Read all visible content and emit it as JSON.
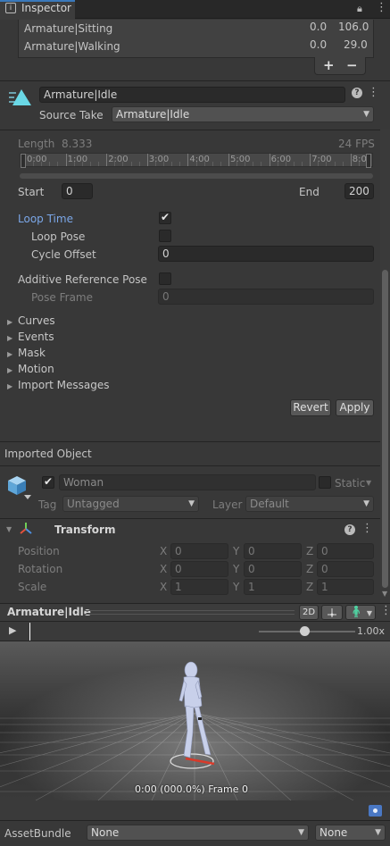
{
  "tab": {
    "title": "Inspector"
  },
  "clips": [
    {
      "name": "Armature|Sitting",
      "start": "0.0",
      "end": "106.0"
    },
    {
      "name": "Armature|Walking",
      "start": "0.0",
      "end": "29.0"
    }
  ],
  "clip_buttons": {
    "add": "+",
    "remove": "−"
  },
  "clip_header": {
    "name": "Armature|Idle",
    "source_take_label": "Source Take",
    "source_take_value": "Armature|Idle"
  },
  "timeline": {
    "length_label": "Length",
    "length_value": "8.333",
    "fps": "24 FPS",
    "ticks": [
      "0:00",
      "1:00",
      "2:00",
      "3:00",
      "4:00",
      "5:00",
      "6:00",
      "7:00",
      "8:0"
    ],
    "start_label": "Start",
    "start_value": "0",
    "end_label": "End",
    "end_value": "200"
  },
  "loop": {
    "loop_time_label": "Loop Time",
    "loop_pose_label": "Loop Pose",
    "cycle_offset_label": "Cycle Offset",
    "cycle_offset_value": "0",
    "additive_label": "Additive Reference Pose",
    "pose_frame_label": "Pose Frame",
    "pose_frame_value": "0"
  },
  "foldouts": [
    "Curves",
    "Events",
    "Mask",
    "Motion",
    "Import Messages"
  ],
  "actions": {
    "revert": "Revert",
    "apply": "Apply"
  },
  "imported": {
    "header": "Imported Object",
    "name": "Woman",
    "static_label": "Static",
    "tag_label": "Tag",
    "tag_value": "Untagged",
    "layer_label": "Layer",
    "layer_value": "Default"
  },
  "transform": {
    "title": "Transform",
    "rows": [
      {
        "label": "Position",
        "x": "0",
        "y": "0",
        "z": "0"
      },
      {
        "label": "Rotation",
        "x": "0",
        "y": "0",
        "z": "0"
      },
      {
        "label": "Scale",
        "x": "1",
        "y": "1",
        "z": "1"
      }
    ],
    "axis": {
      "x": "X",
      "y": "Y",
      "z": "Z"
    }
  },
  "preview": {
    "title": "Armature|Idle",
    "mode_2d": "2D",
    "speed": "1.00x",
    "status": "0:00 (000.0%) Frame 0",
    "speed_fraction": 0.5
  },
  "assetbundle": {
    "label": "AssetBundle",
    "name_value": "None",
    "variant_value": "None"
  },
  "colors": {
    "accent": "#7ba7e8",
    "panel": "#383838",
    "field": "#2a2a2a",
    "tab": "#3c3c3c"
  }
}
